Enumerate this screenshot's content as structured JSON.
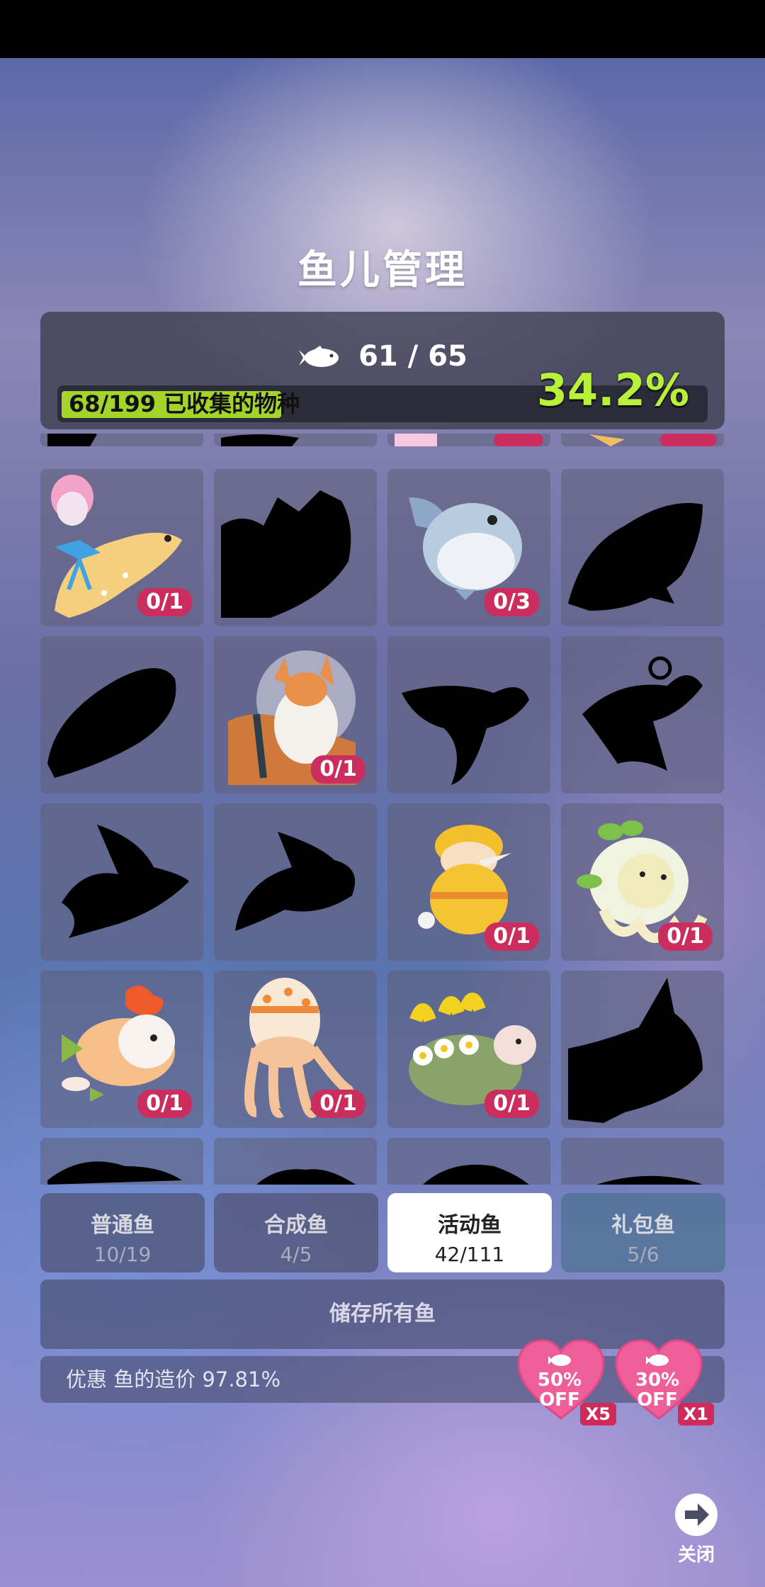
{
  "header": {
    "title": "鱼儿管理"
  },
  "fish_count": "61 / 65",
  "collection": {
    "label": "68/199 已收集的物种",
    "percent": "34.2%",
    "progress": 0.342
  },
  "grid": {
    "rows": [
      [
        {
          "state": "unlocked",
          "art": "rabbit-fish",
          "badge": "0/1"
        },
        {
          "state": "silhouette"
        },
        {
          "state": "unlocked",
          "art": "bird-blowfish",
          "badge": "0/3"
        },
        {
          "state": "silhouette"
        }
      ],
      [
        {
          "state": "silhouette"
        },
        {
          "state": "unlocked",
          "art": "corgi-astronaut",
          "badge": "0/1"
        },
        {
          "state": "silhouette"
        },
        {
          "state": "silhouette"
        }
      ],
      [
        {
          "state": "silhouette"
        },
        {
          "state": "silhouette"
        },
        {
          "state": "unlocked",
          "art": "easter-egg-chick",
          "badge": "0/1"
        },
        {
          "state": "unlocked",
          "art": "sprout-bunny-squid",
          "badge": "0/1"
        }
      ],
      [
        {
          "state": "unlocked",
          "art": "flower-fish",
          "badge": "0/1"
        },
        {
          "state": "unlocked",
          "art": "egg-squid",
          "badge": "0/1"
        },
        {
          "state": "unlocked",
          "art": "flower-turtle",
          "badge": "0/1"
        },
        {
          "state": "silhouette"
        }
      ]
    ]
  },
  "tabs": [
    {
      "name": "普通鱼",
      "count": "10/19"
    },
    {
      "name": "合成鱼",
      "count": "4/5"
    },
    {
      "name": "活动鱼",
      "count": "42/111"
    },
    {
      "name": "礼包鱼",
      "count": "5/6"
    }
  ],
  "store_button": "储存所有鱼",
  "discount": {
    "text": "优惠 鱼的造价 97.81%"
  },
  "coupons": [
    {
      "pct": "50%",
      "off": "OFF",
      "mult": "X5"
    },
    {
      "pct": "30%",
      "off": "OFF",
      "mult": "X1"
    }
  ],
  "close": {
    "label": "关闭"
  },
  "colors": {
    "progress_fill": "#a4d42a",
    "percent_text": "#b8f03a",
    "badge": "#cc2d5f"
  }
}
